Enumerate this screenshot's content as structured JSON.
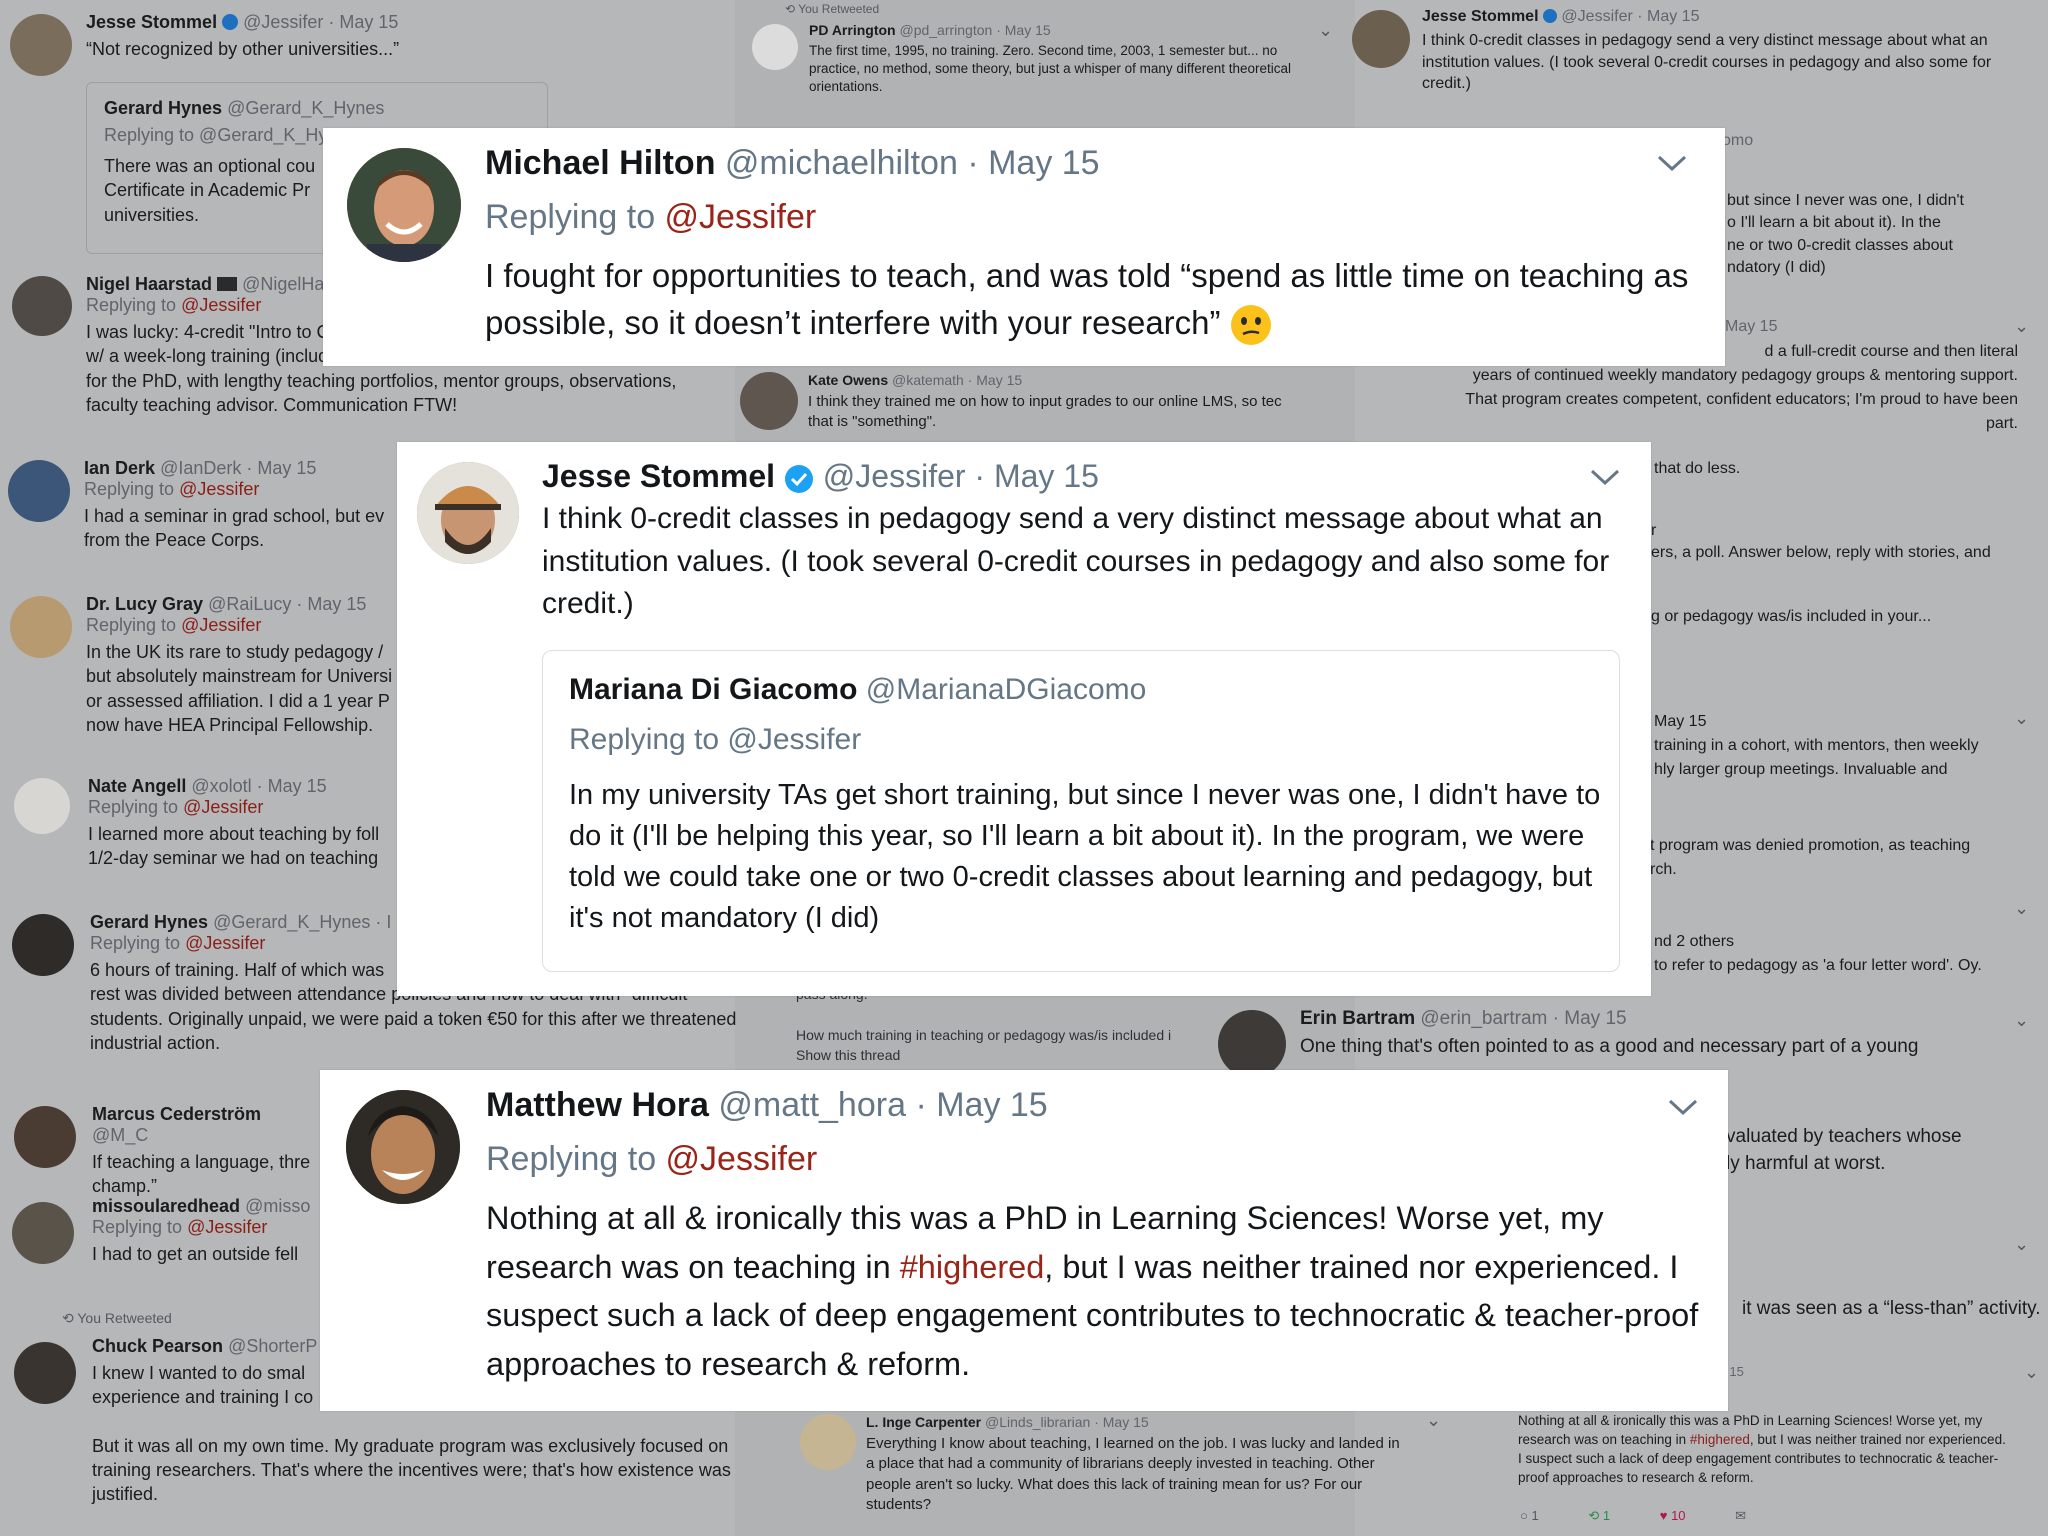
{
  "bg": {
    "left": [
      {
        "name": "Jesse Stommel",
        "handle": "@Jessifer · May 15",
        "text": "“Not recognized by other universities...”"
      },
      {
        "name": "Gerard Hynes",
        "handle": "@Gerard_K_Hynes",
        "reply": "Replying to @Gerard_K_Hy",
        "text": "There was an optional cou\nCertificate in  Academic Pr\nuniversities."
      },
      {
        "name": "Nigel Haarstad",
        "handle": "@NigelHa",
        "reply_pre": "Replying to ",
        "reply_at": "@Jessifer",
        "text": "I was lucky: 4-credit \"Intro to C\nw/ a week-long training (including mock teaching) each year. Another grad class\nfor the PhD, with lengthy teaching portfolios, mentor groups, observations,\nfaculty teaching advisor. Communication FTW!"
      },
      {
        "name": "Ian Derk",
        "handle": "@IanDerk · May 15",
        "reply_pre": "Replying to ",
        "reply_at": "@Jessifer",
        "text": "I had a seminar in grad school, but ev\nfrom the Peace Corps."
      },
      {
        "name": "Dr. Lucy Gray",
        "handle": "@RaiLucy · May 15",
        "reply_pre": "Replying to ",
        "reply_at": "@Jessifer",
        "text": "In the UK its rare to study pedagogy /\nbut absolutely mainstream for Universi\nor assessed affiliation. I did a 1 year P\nnow have HEA Principal Fellowship."
      },
      {
        "name": "Nate Angell",
        "handle": "@xolotl · May 15",
        "reply_pre": "Replying to ",
        "reply_at": "@Jessifer",
        "text": "I learned more about teaching by foll\n1/2-day seminar we had on teaching"
      },
      {
        "name": "Gerard Hynes",
        "handle": "@Gerard_K_Hynes · I",
        "reply_pre": "Replying to ",
        "reply_at": "@Jessifer",
        "text": "6 hours of training. Half of which was\nrest was divided between attendance policies and how to deal with \"difficult\"\nstudents. Originally unpaid, we were paid a token €50 for this after we threatened\nindustrial action."
      },
      {
        "name": "Marcus Cederström",
        "handle": "@M_C",
        "text": "If teaching a language, thre\nchamp.”"
      },
      {
        "name": "missoularedhead",
        "handle": "@misso",
        "reply_pre": "Replying to ",
        "reply_at": "@Jessifer",
        "text": "I had to get an outside fell"
      },
      {
        "retweet": "You Retweeted",
        "name": "Chuck Pearson",
        "handle": "@ShorterP",
        "text": "I knew I wanted to do smal\nexperience and training I co\n\nBut it was all on my own time. My graduate program was exclusively focused on\ntraining researchers. That's where the incentives were; that's how existence was\njustified."
      }
    ],
    "mid": [
      {
        "retweet": "You Retweeted",
        "name": "PD Arrington",
        "handle": "@pd_arrington · May 15",
        "text": "The first time, 1995, no training. Zero. Second time, 2003, 1 semester but... no\npractice, no method, some theory, but just a whisper of many different theoretical\norientations."
      },
      {
        "name": "Kate Owens",
        "handle": "@katemath · May 15",
        "text": "I think they trained me on how to input grades to our online LMS, so tec\nthat is \"something\"."
      },
      {
        "text": "pass along.\n\nHow much training in teaching or pedagogy was/is included i\nShow this thread"
      },
      {
        "name": "L. Inge Carpenter",
        "handle": "@Linds_librarian · May 15",
        "text": "Everything I know about teaching, I learned on the job. I was lucky and landed in\na place that had a community of librarians deeply invested in teaching. Other\npeople aren't so lucky. What does this lack of training mean for us? For our\nstudents?"
      }
    ],
    "right": [
      {
        "name": "Jesse Stommel",
        "handle": "@Jessifer · May 15",
        "text": "I think 0-credit classes in pedagogy send a very distinct message about what an\ninstitution values. (I took several 0-credit courses in pedagogy and also some for\ncredit.)"
      },
      {
        "text": "omo"
      },
      {
        "text": "but since I never was one, I didn't\no I'll learn a bit about it). In the\nne or two 0-credit classes about\nndatory (I did)"
      },
      {
        "text": "May 15"
      },
      {
        "text": "d a full-credit course and then literal\nyears of continued weekly mandatory pedagogy groups & mentoring support.\nThat program creates competent, confident educators; I'm proud to have been\npart."
      },
      {
        "text": "that do less."
      },
      {
        "text": "r\ners, a poll. Answer below, reply with stories, and"
      },
      {
        "text": "g or pedagogy was/is included in your..."
      },
      {
        "text": "May 15\ntraining in a cohort, with mentors, then weekly\nhly larger group meetings. Invaluable and"
      },
      {
        "text": "t program was denied promotion, as teaching\nrch."
      },
      {
        "text": "nd 2 others\n to refer to pedagogy as 'a four letter word'. Oy."
      },
      {
        "name": "Erin Bartram",
        "handle": "@erin_bartram · May 15",
        "text": "One thing that's often pointed to as a good and necessary part of a young"
      },
      {
        "text": "valuated by teachers whose\nly harmful at worst."
      },
      {
        "text": "it was seen as a “less-than” activity."
      },
      {
        "text": "ay 15"
      },
      {
        "text_pre": "Nothing at all & ironically this was a PhD in Learning Sciences! Worse yet, my\nresearch was on teaching in ",
        "text_tag": "#highered",
        "text_post": ", but I was neither trained nor experienced.\nI suspect such a lack of deep engagement contributes to technocratic & teacher-\nproof approaches to research & reform.",
        "counts": {
          "reply": "1",
          "retweet": "1",
          "like": "10"
        }
      }
    ]
  },
  "cards": {
    "hilton": {
      "name": "Michael Hilton",
      "handle": "@michaelhilton",
      "date": "· May 15",
      "reply_pre": "Replying to ",
      "reply_at": "@Jessifer",
      "text": "I fought for opportunities to teach, and was told “spend as little time on teaching as possible, so it doesn’t interfere with your research”"
    },
    "stommel": {
      "name": "Jesse Stommel",
      "handle": "@Jessifer",
      "date": "· May 15",
      "text": "I think 0-credit classes in pedagogy send a very distinct message about what an institution values. (I took several 0-credit courses in pedagogy and also some for credit.)",
      "quote": {
        "name": "Mariana Di Giacomo",
        "handle": "@MarianaDGiacomo",
        "reply": "Replying to @Jessifer",
        "text": "In my university TAs get short training, but since I never was one, I didn't have to do it (I'll be helping this year, so I'll learn a bit about it). In the program, we were told we could take one or two 0-credit classes about learning and pedagogy, but it's not mandatory (I did)"
      }
    },
    "hora": {
      "name": "Matthew Hora",
      "handle": "@matt_hora",
      "date": "· May 15",
      "reply_pre": "Replying to ",
      "reply_at": "@Jessifer",
      "text_pre": "Nothing at all & ironically this was a PhD in Learning Sciences! Worse yet, my research was on teaching in ",
      "text_tag": "#highered",
      "text_post": ", but I was neither trained nor experienced. I suspect such a lack of deep engagement contributes to technocratic & teacher-proof approaches to research & reform."
    }
  },
  "icons": {
    "verified": "verified-badge-icon",
    "chevron": "chevron-down-icon",
    "emoji": "confused-face-emoji-icon"
  },
  "colors": {
    "mention": "#9a2418",
    "verified": "#1da1f2",
    "muted": "#657786"
  }
}
